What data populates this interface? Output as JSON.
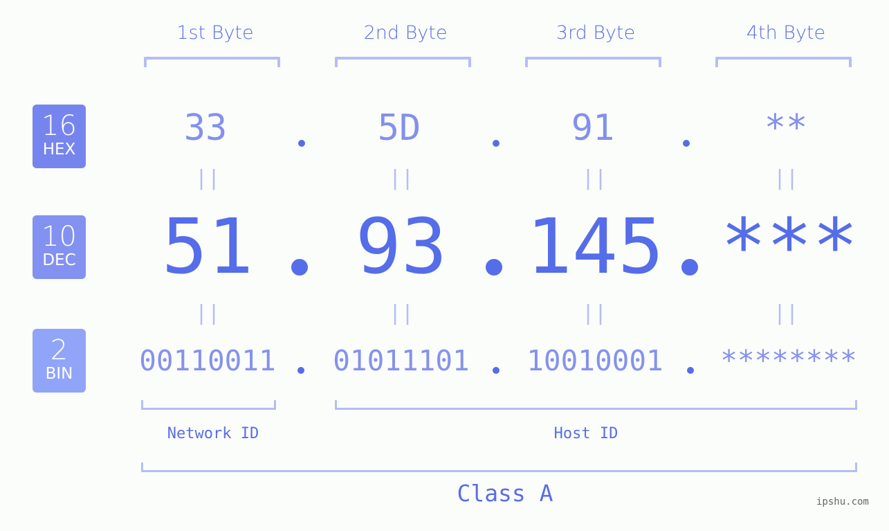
{
  "bytes": {
    "labels": [
      "1st Byte",
      "2nd Byte",
      "3rd Byte",
      "4th Byte"
    ]
  },
  "badges": {
    "hex": {
      "num": "16",
      "label": "HEX",
      "color": "#7685ee"
    },
    "dec": {
      "num": "10",
      "label": "DEC",
      "color": "#8391f1"
    },
    "bin": {
      "num": "2",
      "label": "BIN",
      "color": "#90a5f7"
    }
  },
  "hex": {
    "values": [
      "33",
      "5D",
      "91",
      "**"
    ],
    "separator": "."
  },
  "dec": {
    "values": [
      "51",
      "93",
      "145",
      "***"
    ],
    "separator": "."
  },
  "bin": {
    "values": [
      "00110011",
      "01011101",
      "10010001",
      "********"
    ],
    "separator": "."
  },
  "equals_symbol": "||",
  "segments": {
    "network_id": "Network ID",
    "host_id": "Host ID"
  },
  "class_label": "Class A",
  "watermark": "ipshu.com",
  "colors": {
    "accent": "#556de9",
    "bracket": "#b6bdf6",
    "hex_text": "#8390ec",
    "bin_text": "#8592ec",
    "background": "#fbfdfb"
  }
}
